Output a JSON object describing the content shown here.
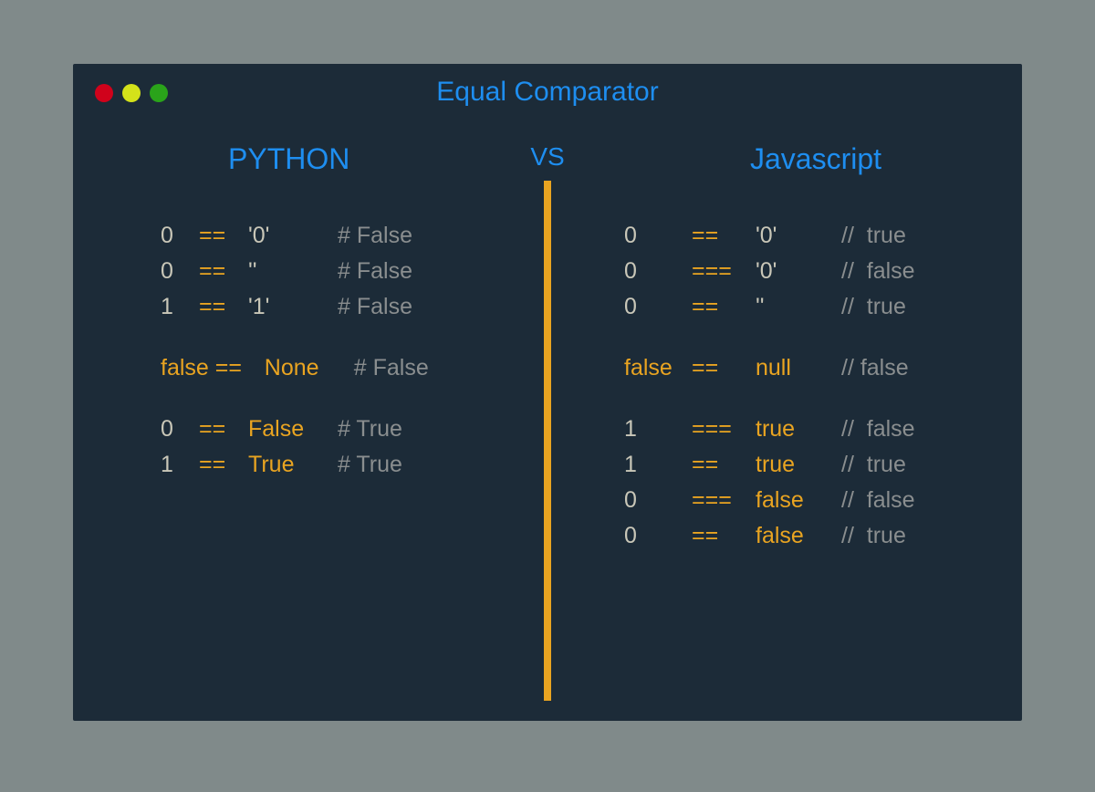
{
  "title": "Equal Comparator",
  "vs": "VS",
  "columns": {
    "left": {
      "title": "PYTHON"
    },
    "right": {
      "title": "Javascript"
    }
  },
  "python": [
    {
      "lhs": "0",
      "op": "==",
      "rhs": "'0'",
      "res": "# False"
    },
    {
      "lhs": "0",
      "op": "==",
      "rhs": "''",
      "res": "# False"
    },
    {
      "lhs": "1",
      "op": "==",
      "rhs": "'1'",
      "res": "# False"
    },
    {
      "gap": true
    },
    {
      "lhs": "false",
      "lhs_kw": true,
      "op": "==",
      "rhs": "None",
      "rhs_kw": true,
      "res": "# False"
    },
    {
      "gap": true
    },
    {
      "lhs": "0",
      "op": "==",
      "rhs": "False",
      "rhs_kw": true,
      "res": "# True"
    },
    {
      "lhs": "1",
      "op": "==",
      "rhs": "True",
      "rhs_kw": true,
      "res": "# True"
    }
  ],
  "javascript": [
    {
      "lhs": "0",
      "op": "==",
      "rhs": "'0'",
      "res": "//  true"
    },
    {
      "lhs": "0",
      "op": "===",
      "rhs": "'0'",
      "res": "//  false"
    },
    {
      "lhs": "0",
      "op": "==",
      "rhs": "''",
      "res": "//  true"
    },
    {
      "gap": true
    },
    {
      "lhs": "false",
      "lhs_kw": true,
      "op": "==",
      "rhs": "null",
      "rhs_kw": true,
      "res": "// false"
    },
    {
      "gap": true
    },
    {
      "lhs": "1",
      "op": "===",
      "rhs": "true",
      "rhs_kw": true,
      "res": "//  false"
    },
    {
      "lhs": "1",
      "op": "==",
      "rhs": "true",
      "rhs_kw": true,
      "res": "//  true"
    },
    {
      "lhs": "0",
      "op": "===",
      "rhs": "false",
      "rhs_kw": true,
      "res": "//  false"
    },
    {
      "lhs": "0",
      "op": "==",
      "rhs": "false",
      "rhs_kw": true,
      "res": "//  true"
    }
  ]
}
